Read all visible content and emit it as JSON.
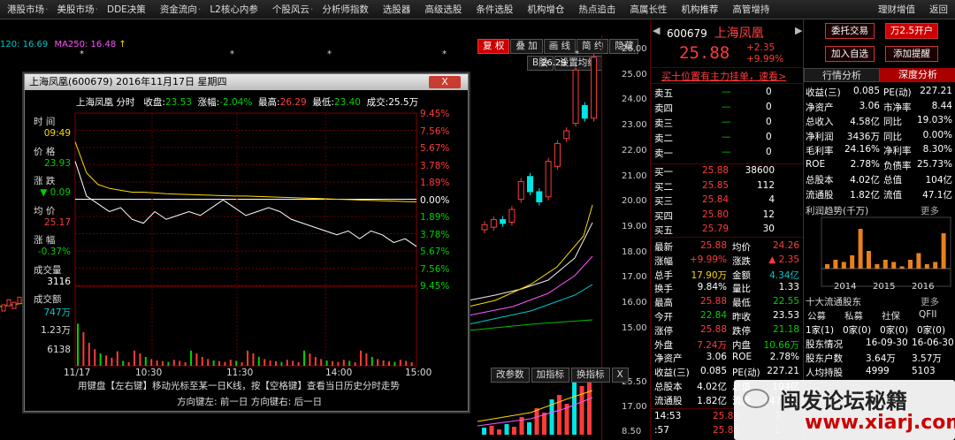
{
  "menu": [
    "港股市场",
    "美股市场",
    "DDE决策",
    "资金流向",
    "L2核心内参",
    "个股风云",
    "分析师指数",
    "选股器",
    "高级选股",
    "条件选股",
    "机构增仓",
    "热点追击",
    "高属长性",
    "机构推荐",
    "高管增持",
    "理财增值",
    "返回"
  ],
  "menu_arrows": [
    "·",
    "·",
    "",
    "·",
    "",
    "·",
    "",
    "",
    "",
    "",
    "",
    "",
    "",
    "",
    "",
    "",
    ""
  ],
  "toolbar": {
    "fuquan": "复 权",
    "overlay": "叠 加",
    "draw": "画 线",
    "simple": "简 约",
    "hide": "隐藏",
    "b_share": "B股",
    "set_ma": "设置均线"
  },
  "ma_bar": {
    "prefix": "120: 16.69",
    "ma250": "MA250: 16.48",
    "arrow": "↑"
  },
  "kline": {
    "high_label": "26.29",
    "stars": [
      "*",
      "*",
      "*",
      "*",
      "*"
    ],
    "price_ticks": [
      "26.00",
      "25.00",
      "24.00",
      "23.00",
      "22.00",
      "21.00",
      "20.00",
      "19.00",
      "18.00",
      "17.00",
      "16.00",
      "15.00"
    ],
    "vol_ticks": [
      "25.50",
      "17.00",
      "8.50"
    ],
    "sub_buttons": {
      "params": "改参数",
      "add": "加指标",
      "switch": "换指标",
      "close": "X"
    },
    "candles": [
      {
        "o": 19.1,
        "c": 19.3
      },
      {
        "o": 19.2,
        "c": 19.5
      },
      {
        "o": 19.5,
        "c": 19.35
      },
      {
        "o": 19.4,
        "c": 19.9
      },
      {
        "o": 20.3,
        "c": 21.0
      },
      {
        "o": 21.2,
        "c": 20.6
      },
      {
        "o": 20.6,
        "c": 20.2
      },
      {
        "o": 20.4,
        "c": 21.8
      },
      {
        "o": 21.6,
        "c": 22.5
      },
      {
        "o": 22.7,
        "c": 23.0
      },
      {
        "o": 23.3,
        "c": 25.4
      },
      {
        "o": 24.0,
        "c": 23.5
      },
      {
        "o": 23.5,
        "c": 25.9
      }
    ],
    "left_candles": [
      16.0,
      16.2,
      16.1,
      16.3,
      16.2
    ]
  },
  "popup": {
    "title": "上海凤凰(600679) 2016年11月17日 星期四",
    "close": "X",
    "chart_name": "上海凤凰 分时",
    "close_lbl": "收盘:",
    "close_val": "23.53",
    "chg_lbl": "涨幅:",
    "chg_val": "-2.04%",
    "high_lbl": "最高:",
    "high_val": "26.29",
    "low_lbl": "最低:",
    "low_val": "23.40",
    "vol_lbl": "成交:",
    "vol_val": "25.5万",
    "side": [
      {
        "lbl": "时 间",
        "val": "09:49",
        "c": "yellow"
      },
      {
        "lbl": "价 格",
        "val": "23.93",
        "c": "green"
      },
      {
        "lbl": "涨 跌",
        "val": "▼ 0.09",
        "c": "green"
      },
      {
        "lbl": "均 价",
        "val": "25.17",
        "c": "red"
      },
      {
        "lbl": "涨 幅",
        "val": "-0.37%",
        "c": "green"
      },
      {
        "lbl": "成交量",
        "val": "3116",
        "c": "white"
      },
      {
        "lbl": "成交额",
        "val": "747万",
        "c": "cyan"
      }
    ],
    "pct_ticks": [
      "9.45%",
      "7.56%",
      "5.67%",
      "3.78%",
      "1.89%",
      "0.00%",
      "1.89%",
      "3.78%",
      "5.67%",
      "7.56%",
      "9.45%"
    ],
    "vol_ticks": [
      "1.23万",
      "6138"
    ],
    "time_ticks": [
      "11/17",
      "10:30",
      "11:30",
      "14:00",
      "15:00"
    ],
    "hint1": "用键盘【左右键】移动光标至某一日K线，按【空格键】查看当日历史分时走势",
    "hint2": "方向键左: 前一日    方向键右: 后一日",
    "price_line": [
      24.5,
      23.6,
      23.4,
      23.2,
      23.3,
      23.0,
      22.9,
      23.2,
      23.0,
      23.1,
      23.2,
      23.1,
      23.3,
      23.5,
      23.3,
      23.1,
      23.2,
      23.3,
      23.2,
      23.0,
      22.9,
      22.8,
      22.7,
      22.6,
      22.7,
      22.5,
      22.7,
      22.6,
      22.4,
      22.5,
      22.3
    ],
    "avg_line": [
      25.0,
      24.2,
      23.9,
      23.8,
      23.75,
      23.7,
      23.7,
      23.68,
      23.66,
      23.65,
      23.64,
      23.63,
      23.62,
      23.61,
      23.6,
      23.6,
      23.59,
      23.58,
      23.57,
      23.56,
      23.55,
      23.54,
      23.53,
      23.52,
      23.51,
      23.5,
      23.49,
      23.48,
      23.47,
      23.46,
      23.45
    ]
  },
  "quote": {
    "code": "600679",
    "name": "上海凤凰",
    "price": "25.88",
    "change": "+2.35",
    "change_pct": "+9.99%",
    "btn_trade": "委托交易",
    "btn_open": "万2.5开户",
    "btn_add": "加入自选",
    "btn_alert": "添加提醒",
    "banner": "买十位置有主力挂单，速看>",
    "asks": [
      {
        "l": "卖五",
        "p": "—",
        "v": "0"
      },
      {
        "l": "卖四",
        "p": "—",
        "v": "0"
      },
      {
        "l": "卖三",
        "p": "—",
        "v": "0"
      },
      {
        "l": "卖二",
        "p": "—",
        "v": "0"
      },
      {
        "l": "卖一",
        "p": "—",
        "v": "0"
      }
    ],
    "bids": [
      {
        "l": "买一",
        "p": "25.88",
        "v": "38600"
      },
      {
        "l": "买二",
        "p": "25.85",
        "v": "112"
      },
      {
        "l": "买三",
        "p": "25.84",
        "v": "4"
      },
      {
        "l": "买四",
        "p": "25.80",
        "v": "12"
      },
      {
        "l": "买五",
        "p": "25.79",
        "v": "30"
      }
    ],
    "stats": [
      [
        "最新",
        "25.88",
        "red",
        "均价",
        "24.26",
        "red"
      ],
      [
        "涨幅",
        "+9.99%",
        "red",
        "涨跌",
        "▲ 2.35",
        "red"
      ],
      [
        "总手",
        "17.90万",
        "yellow",
        "金额",
        "4.34亿",
        "cyan"
      ],
      [
        "换手",
        "9.84%",
        "white",
        "量比",
        "1.33",
        "white"
      ],
      [
        "最高",
        "25.88",
        "red",
        "最低",
        "22.55",
        "green"
      ],
      [
        "今开",
        "22.84",
        "green",
        "昨收",
        "23.53",
        "white"
      ],
      [
        "涨停",
        "25.88",
        "red",
        "跌停",
        "21.18",
        "green"
      ],
      [
        "外盘",
        "7.24万",
        "red",
        "内盘",
        "10.66万",
        "green"
      ],
      [
        "净资产",
        "3.06",
        "white",
        "ROE",
        "2.78%",
        "white"
      ],
      [
        "收益(三)",
        "0.085",
        "white",
        "PE(动)",
        "227.21",
        "white"
      ],
      [
        "总股本",
        "4.02亿",
        "white",
        "总值",
        "104亿",
        "white"
      ],
      [
        "流通股",
        "1.82亿",
        "white",
        "流值",
        "47.1亿",
        "white"
      ]
    ],
    "tick": [
      {
        "t": "14:53",
        "p": "25.88",
        "v": "3"
      },
      {
        "t": ":57",
        "p": "25.88",
        "v": "1"
      }
    ]
  },
  "depth": {
    "tab1": "行情分析",
    "tab2": "深度分析",
    "rows": [
      [
        "收益(三)",
        "0.085",
        "PE(动)",
        "227.21"
      ],
      [
        "净资产",
        "3.06",
        "市净率",
        "8.44"
      ],
      [
        "总收入",
        "4.58亿",
        "同比",
        "19.03%"
      ],
      [
        "净利润",
        "3436万",
        "同比",
        "0.00%"
      ],
      [
        "毛利率",
        "24.16%",
        "净利率",
        "8.30%"
      ],
      [
        "ROE",
        "2.78%",
        "负债率",
        "25.73%"
      ],
      [
        "总股本",
        "4.02亿",
        "总值",
        "104亿"
      ],
      [
        "流通股",
        "1.82亿",
        "流值",
        "47.1亿"
      ]
    ],
    "profit_title": "利润趋势(千万)",
    "more": "更多",
    "bars": [
      0.1,
      0.2,
      0.15,
      0.3,
      0.9,
      0.4,
      0.1,
      0.2,
      0.15,
      0.05,
      0.2,
      0.35,
      0.1,
      0.15,
      0.8
    ],
    "years": [
      "2014",
      "2015",
      "2016"
    ],
    "holders_title": "十大流通股东",
    "holders_head": [
      "公募",
      "私募",
      "社保",
      "QFII"
    ],
    "holders_vals": [
      "1家(1)",
      "0家(0)",
      "0家(0)",
      "0家(0)"
    ],
    "table": [
      [
        "股东情况",
        "16-09-30",
        "16-06-30"
      ],
      [
        "股东户数",
        "3.64万",
        "3.57万"
      ],
      [
        "人均持股",
        "4999",
        "5103"
      ]
    ]
  },
  "watermark": {
    "brand": "闽发论坛秘籍",
    "url": "www.xiarj.com"
  }
}
